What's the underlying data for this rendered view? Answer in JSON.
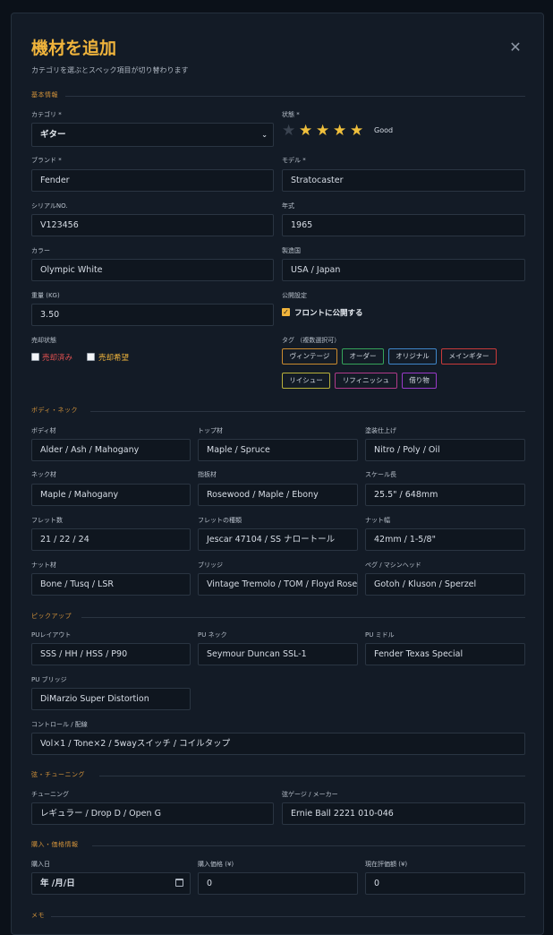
{
  "modal": {
    "title": "機材を追加",
    "subtitle": "カテゴリを選ぶとスペック項目が切り替わります"
  },
  "basic": {
    "section": "基本情報",
    "category_label": "カテゴリ *",
    "category_value": "ギター",
    "condition_label": "状態 *",
    "rating": 4,
    "rating_max": 5,
    "rating_text": "Good",
    "brand_label": "ブランド *",
    "brand_value": "Fender",
    "model_label": "モデル *",
    "model_value": "Stratocaster",
    "serial_label": "シリアルNO.",
    "serial_value": "V123456",
    "year_label": "年式",
    "year_value": "1965",
    "color_label": "カラー",
    "color_value": "Olympic White",
    "country_label": "製造国",
    "country_value": "USA / Japan",
    "weight_label": "重量 (KG)",
    "weight_value": "3.50",
    "publish_label": "公開設定",
    "publish_checkbox": "フロントに公開する",
    "sale_label": "売却状態",
    "sold_checkbox": "売却済み",
    "wish_checkbox": "売却希望",
    "tags_label": "タグ （複数選択可）",
    "tags": [
      {
        "label": "ヴィンテージ",
        "color": "#c98a2e"
      },
      {
        "label": "オーダー",
        "color": "#35a35a"
      },
      {
        "label": "オリジナル",
        "color": "#3f86c9"
      },
      {
        "label": "メインギター",
        "color": "#c83a3a"
      },
      {
        "label": "リイシュー",
        "color": "#b8b03a"
      },
      {
        "label": "リフィニッシュ",
        "color": "#b03a8a"
      },
      {
        "label": "借り物",
        "color": "#9a3ac8"
      }
    ]
  },
  "body_neck": {
    "section": "ボディ・ネック",
    "body_label": "ボディ材",
    "body_value": "Alder / Ash / Mahogany",
    "top_label": "トップ材",
    "top_value": "Maple / Spruce",
    "finish_label": "塗装仕上げ",
    "finish_value": "Nitro / Poly / Oil",
    "neck_label": "ネック材",
    "neck_value": "Maple / Mahogany",
    "fingerboard_label": "指板材",
    "fingerboard_value": "Rosewood / Maple / Ebony",
    "scale_label": "スケール長",
    "scale_value": "25.5\" / 648mm",
    "frets_label": "フレット数",
    "frets_value": "21 / 22 / 24",
    "fret_type_label": "フレットの種類",
    "fret_type_value": "Jescar 47104 / SS ナロートール",
    "nut_width_label": "ナット幅",
    "nut_width_value": "42mm / 1-5/8\"",
    "nut_label": "ナット材",
    "nut_value": "Bone / Tusq / LSR",
    "bridge_label": "ブリッジ",
    "bridge_value": "Vintage Tremolo / TOM / Floyd Rose",
    "pegs_label": "ペグ / マシンヘッド",
    "pegs_value": "Gotoh / Kluson / Sperzel"
  },
  "pickup": {
    "section": "ピックアップ",
    "layout_label": "PUレイアウト",
    "layout_value": "SSS / HH / HSS / P90",
    "neck_label": "PU ネック",
    "neck_value": "Seymour Duncan SSL-1",
    "middle_label": "PU ミドル",
    "middle_value": "Fender Texas Special",
    "bridge_label": "PU ブリッジ",
    "bridge_value": "DiMarzio Super Distortion",
    "control_label": "コントロール / 配線",
    "control_value": "Vol×1 / Tone×2 / 5wayスイッチ / コイルタップ"
  },
  "strings": {
    "section": "弦・チューニング",
    "tuning_label": "チューニング",
    "tuning_value": "レギュラー / Drop D / Open G",
    "gauge_label": "弦ゲージ / メーカー",
    "gauge_value": "Ernie Ball 2221 010-046"
  },
  "purchase": {
    "section": "購入・価格情報",
    "date_label": "購入日",
    "date_value": "年 /月/日",
    "price_label": "購入価格 (¥)",
    "price_value": "0",
    "value_label": "現在評価額 (¥)",
    "value_value": "0"
  },
  "memo": {
    "section": "メモ"
  },
  "colors": {
    "accent": "#f0b43c",
    "sold": "#e05050",
    "wish": "#f0b43c"
  }
}
